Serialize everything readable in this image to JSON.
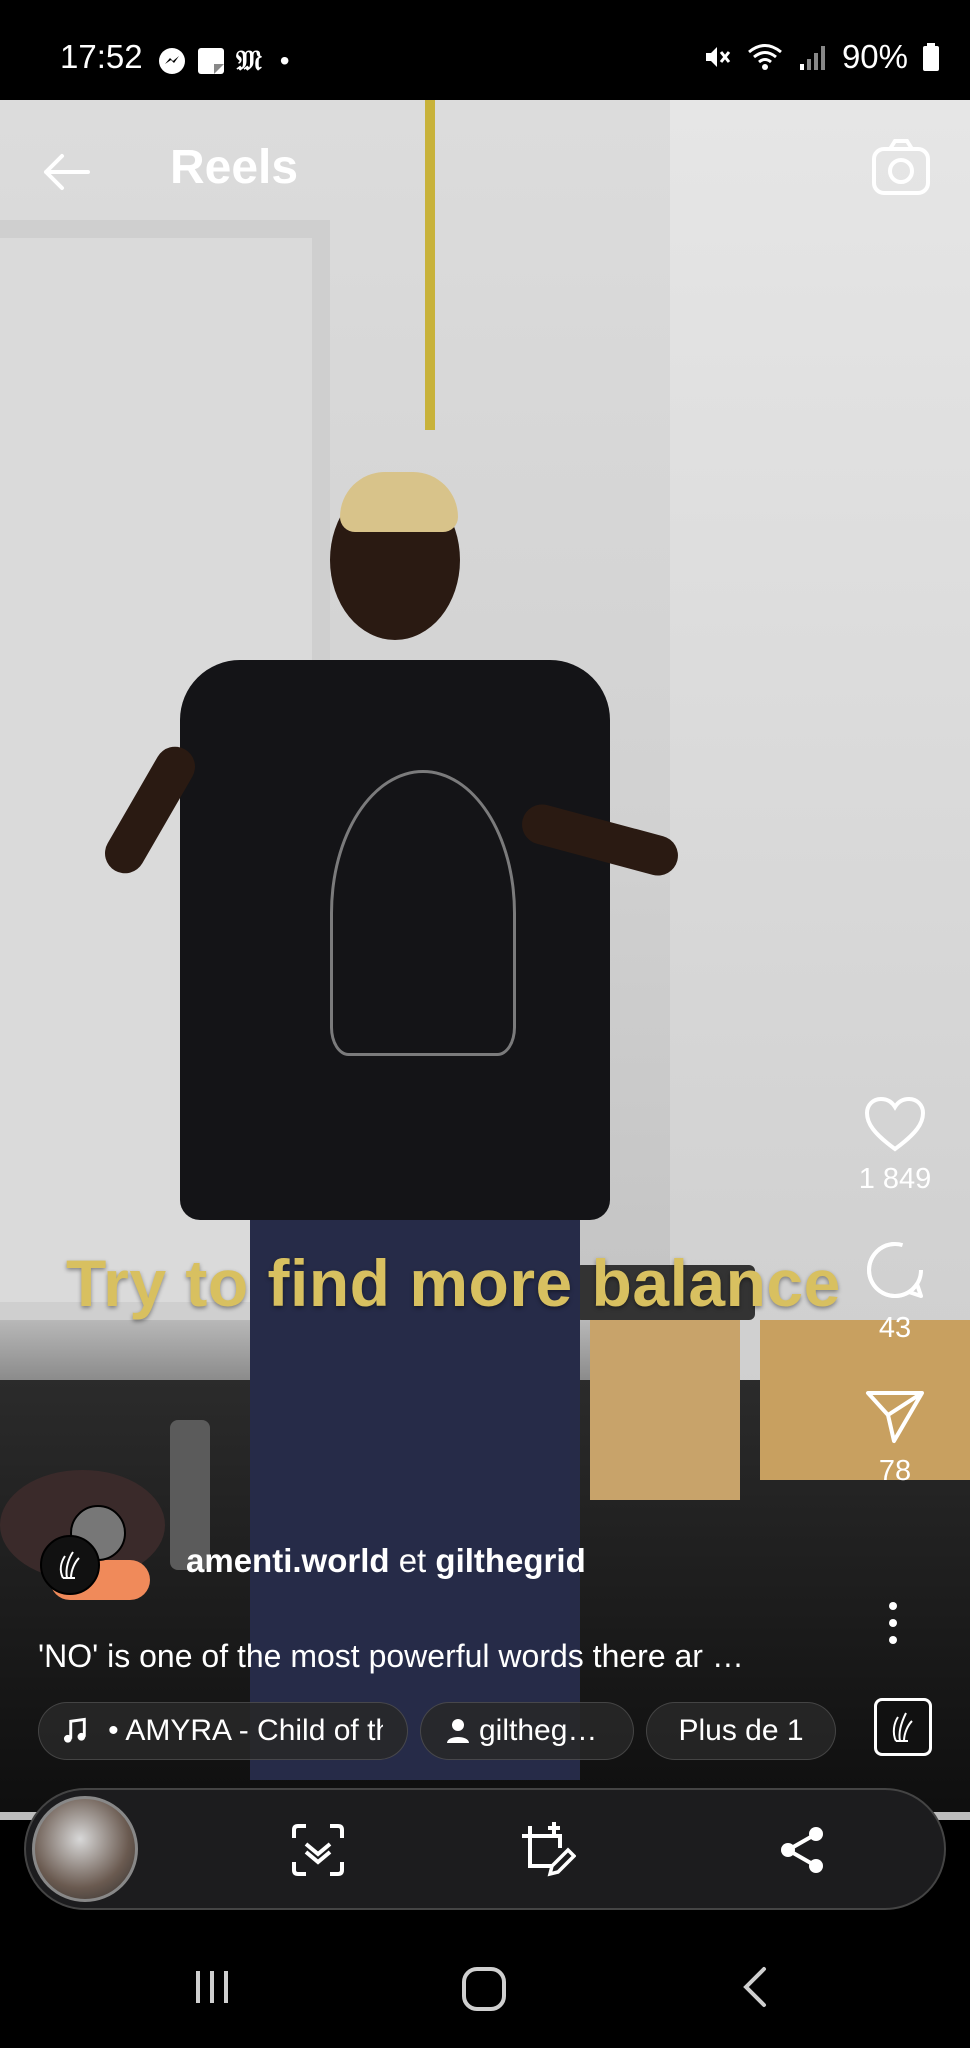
{
  "status_bar": {
    "time": "17:52",
    "notification_icons": [
      "messenger-icon",
      "notes-icon",
      "gothic-m-icon",
      "dot-icon"
    ],
    "battery": "90%",
    "indicators": [
      "mute-icon",
      "wifi-icon",
      "signal-icon",
      "battery-icon"
    ]
  },
  "header": {
    "title": "Reels",
    "back_icon": "back-arrow-icon",
    "camera_icon": "camera-icon"
  },
  "video": {
    "overlay_caption": "Try to find more balance"
  },
  "actions": {
    "likes": "1 849",
    "comments": "43",
    "shares": "78"
  },
  "author": {
    "primary": "amenti.world",
    "connector": "et",
    "secondary": "gilthegrid"
  },
  "caption": "'NO' is one of the most powerful words there ar …",
  "chips": {
    "music": "• AMYRA - Child of th",
    "user": "giltheg…",
    "more": "Plus de 1"
  },
  "dock": {
    "buttons": [
      "scan-icon",
      "edit-crop-icon",
      "share-icon"
    ]
  },
  "nav": {
    "buttons": [
      "recents-icon",
      "home-icon",
      "back-icon"
    ]
  }
}
